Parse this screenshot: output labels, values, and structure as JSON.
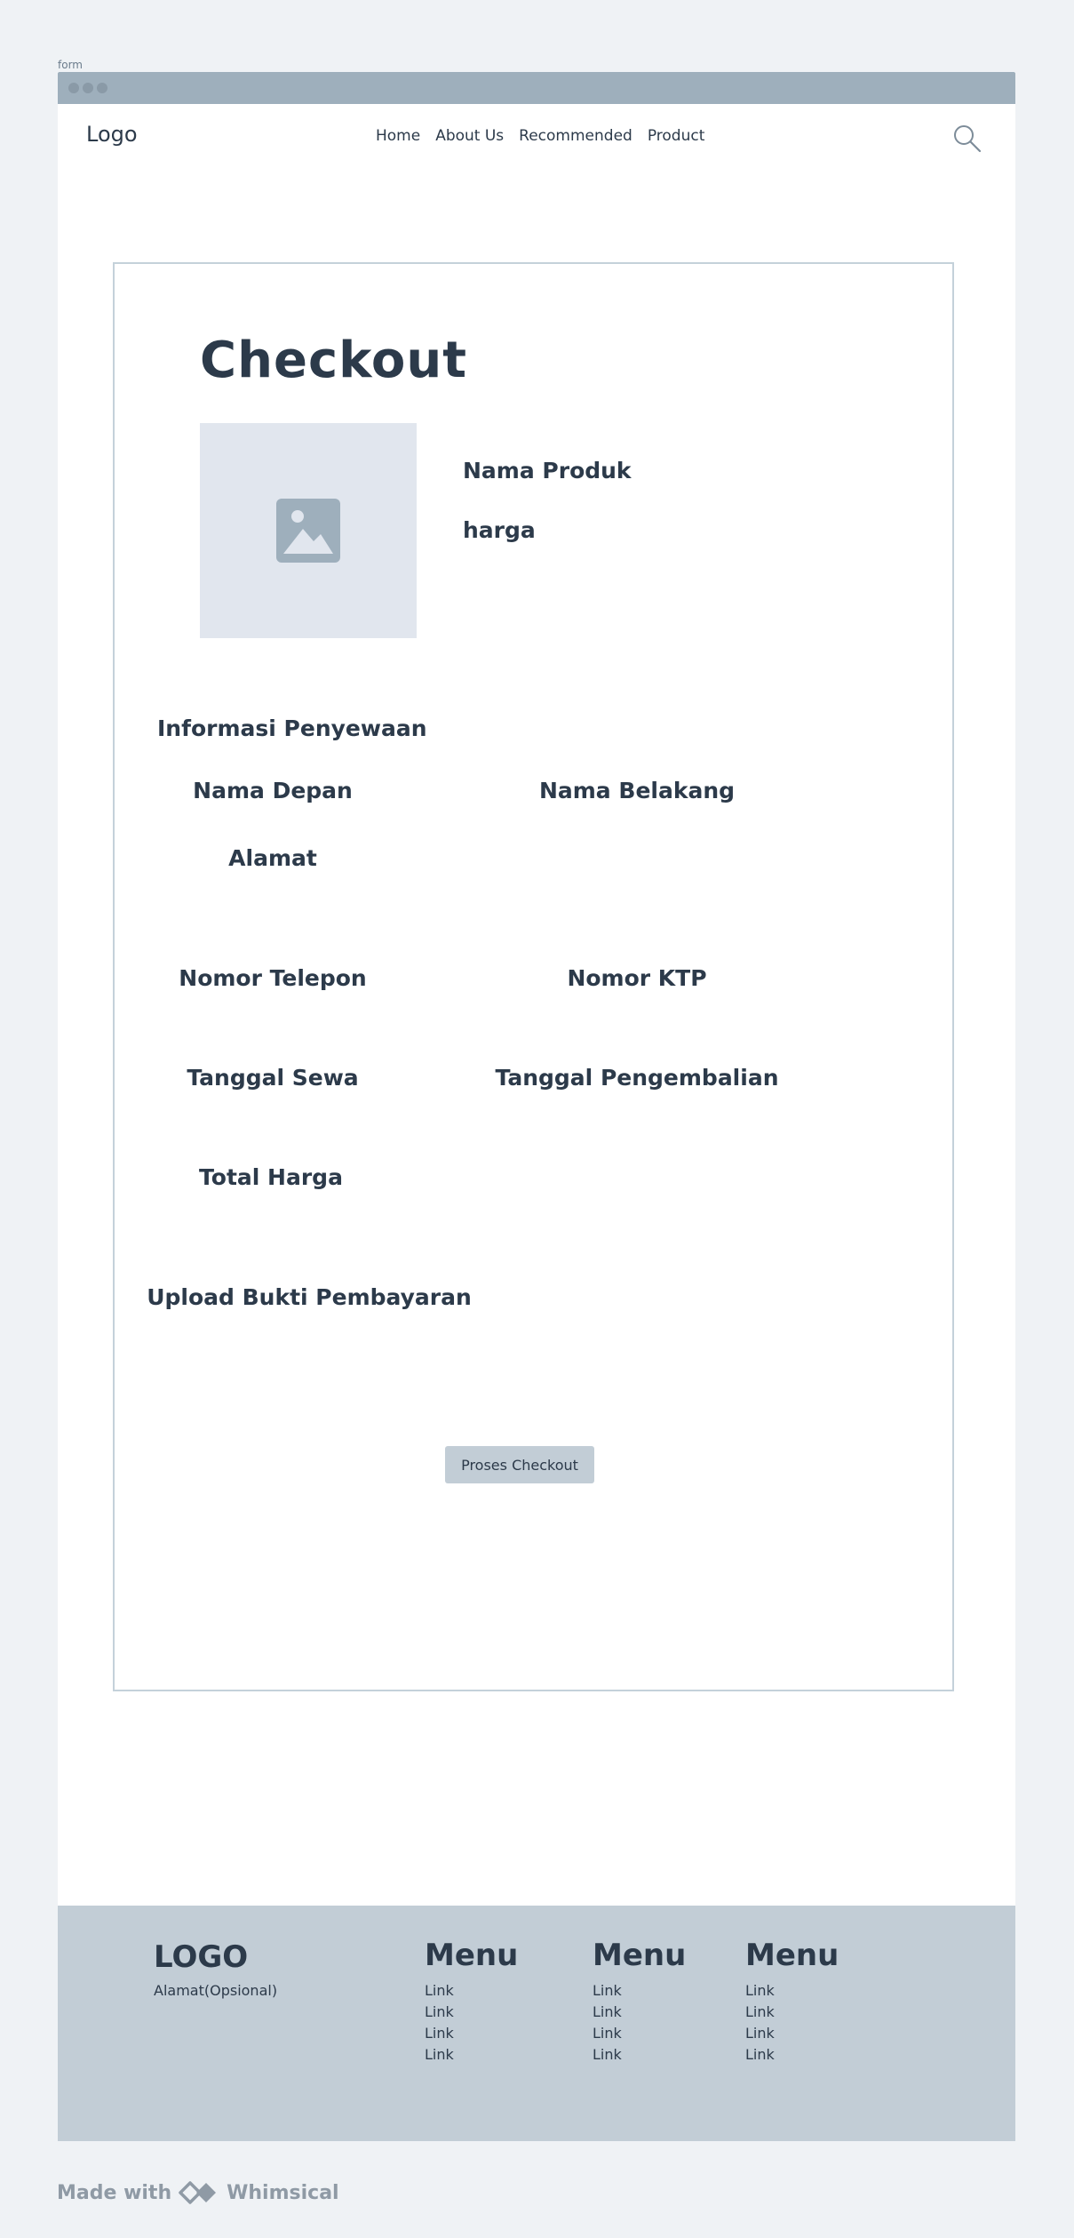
{
  "frame_label": "form",
  "nav": {
    "logo": "Logo",
    "links": [
      "Home",
      "About Us",
      "Recommended",
      "Product"
    ]
  },
  "checkout": {
    "title": "Checkout",
    "product_name": "Nama Produk",
    "product_price": "harga",
    "section_title": "Informasi Penyewaan",
    "fields": {
      "first_name": "Nama Depan",
      "last_name": "Nama Belakang",
      "address": "Alamat",
      "phone": "Nomor Telepon",
      "ktp": "Nomor KTP",
      "rent_date": "Tanggal Sewa",
      "return_date": "Tanggal Pengembalian",
      "total_price": "Total Harga",
      "upload_proof": "Upload Bukti Pembayaran"
    },
    "submit_label": "Proses Checkout"
  },
  "footer": {
    "logo": "LOGO",
    "address": "Alamat(Opsional)",
    "columns": [
      {
        "title": "Menu",
        "links": [
          "Link",
          "Link",
          "Link",
          "Link"
        ]
      },
      {
        "title": "Menu",
        "links": [
          "Link",
          "Link",
          "Link",
          "Link"
        ]
      },
      {
        "title": "Menu",
        "links": [
          "Link",
          "Link",
          "Link",
          "Link"
        ]
      }
    ]
  },
  "made_with": {
    "prefix": "Made with",
    "brand": "Whimsical"
  },
  "icons": [
    "search-icon",
    "image-placeholder-icon",
    "whimsical-logo-icon"
  ]
}
